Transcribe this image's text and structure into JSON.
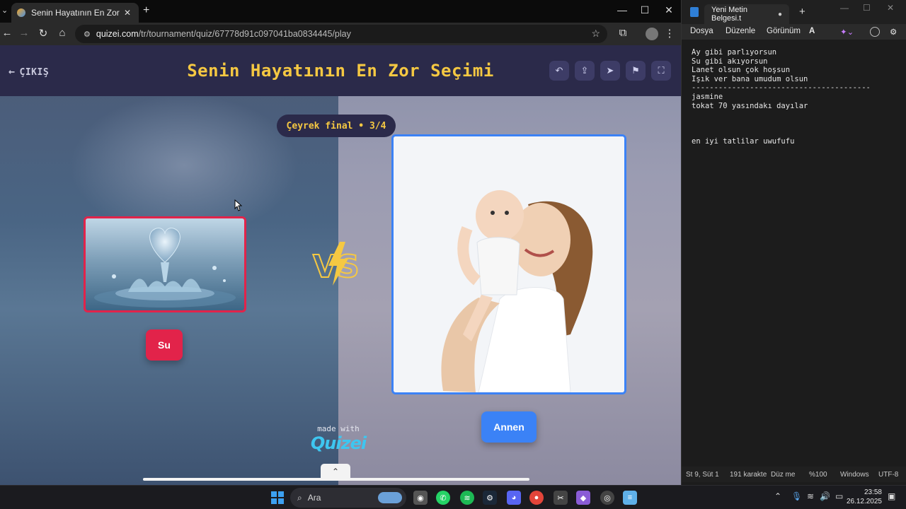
{
  "browser": {
    "tab_title": "Senin Hayatının En Zor Seçimi",
    "url_domain": "quizei.com",
    "url_path": "/tr/tournament/quiz/67778d91c097041ba0834445/play"
  },
  "quiz": {
    "back_label": "ÇIKIŞ",
    "title": "Senin Hayatının En Zor Seçimi",
    "round_label": "Çeyrek final • 3/4",
    "vs_label": "VS",
    "left_choice": "Su",
    "right_choice": "Annen",
    "made_with": "made with",
    "brand": "Quizei"
  },
  "notepad": {
    "tab_title": "Yeni Metin Belgesi.t",
    "menu": [
      "Dosya",
      "Düzenle",
      "Görünüm"
    ],
    "text": "Ay gibi parlıyorsun\nSu gibi akıyorsun\nLanet olsun çok hoşsun\nIşık ver bana umudum olsun\n----------------------------------------\njasmine\ntokat 70 yasındakı dayılar\n\n\n\nen iyi tatlilar uwufufu",
    "status": {
      "position": "St 9, Süt 1",
      "chars": "191 karakte",
      "mode": "Düz me",
      "zoom": "%100",
      "eol": "Windows",
      "encoding": "UTF-8"
    }
  },
  "taskbar": {
    "search_label": "Ara",
    "time": "23:58",
    "date": "26.12.2025"
  },
  "colors": {
    "header_bg": "#2b2a4a",
    "title_yellow": "#f5c842",
    "left_accent": "#e2234a",
    "right_accent": "#3b82f6"
  }
}
